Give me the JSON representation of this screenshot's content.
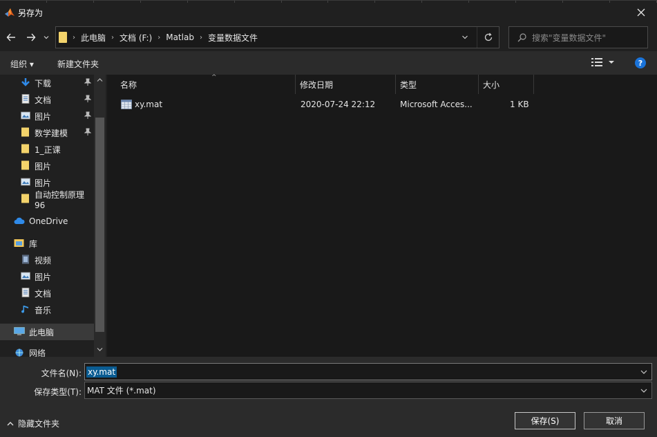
{
  "window": {
    "title": "另存为"
  },
  "address": {
    "crumbs": [
      "此电脑",
      "文档 (F:)",
      "Matlab",
      "变量数据文件"
    ]
  },
  "search": {
    "placeholder": "搜索\"变量数据文件\""
  },
  "toolbar": {
    "organize": "组织 ▾",
    "new_folder": "新建文件夹",
    "help": "?"
  },
  "sidebar": {
    "items": [
      {
        "label": "下载",
        "icon": "download-icon",
        "pinned": true
      },
      {
        "label": "文档",
        "icon": "document-icon",
        "pinned": true
      },
      {
        "label": "图片",
        "icon": "picture-icon",
        "pinned": true
      },
      {
        "label": "数学建模",
        "icon": "folder-icon",
        "pinned": true
      },
      {
        "label": "1_正课",
        "icon": "folder-icon",
        "pinned": false
      },
      {
        "label": "图片",
        "icon": "folder-icon",
        "pinned": false
      },
      {
        "label": "图片",
        "icon": "picture-icon",
        "pinned": false
      },
      {
        "label": "自动控制原理96",
        "icon": "folder-icon",
        "pinned": false
      },
      {
        "label": "OneDrive",
        "icon": "cloud-icon",
        "pinned": false
      },
      {
        "label": "库",
        "icon": "library-icon",
        "pinned": false
      },
      {
        "label": "视频",
        "icon": "video-icon",
        "pinned": false
      },
      {
        "label": "图片",
        "icon": "picture-icon",
        "pinned": false
      },
      {
        "label": "文档",
        "icon": "document-icon",
        "pinned": false
      },
      {
        "label": "音乐",
        "icon": "music-icon",
        "pinned": false
      },
      {
        "label": "此电脑",
        "icon": "computer-icon",
        "pinned": false
      },
      {
        "label": "网络",
        "icon": "network-icon",
        "pinned": false
      }
    ]
  },
  "columns": {
    "name": "名称",
    "date": "修改日期",
    "type": "类型",
    "size": "大小"
  },
  "files": [
    {
      "name": "xy.mat",
      "date": "2020-07-24 22:12",
      "type": "Microsoft Acces...",
      "size": "1 KB"
    }
  ],
  "form": {
    "filename_label": "文件名(N):",
    "filename_value": "xy.mat",
    "filetype_label": "保存类型(T):",
    "filetype_value": "MAT 文件 (*.mat)"
  },
  "footer": {
    "hide_folders": "隐藏文件夹",
    "save": "保存(S)",
    "cancel": "取消"
  }
}
